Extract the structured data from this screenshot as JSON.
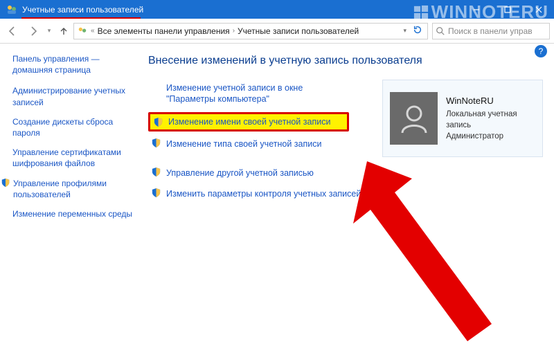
{
  "titlebar": {
    "title": "Учетные записи пользователей"
  },
  "watermark": "WINNOTERU",
  "toolbar": {
    "dropdown_glyph": "▾",
    "breadcrumb_back_glyph": "«",
    "crumb1": "Все элементы панели управления",
    "crumb2": "Учетные записи пользователей",
    "search_placeholder": "Поиск в панели управ"
  },
  "sidebar": {
    "heading": "Панель управления — домашняя страница",
    "links": [
      "Администрирование учетных записей",
      "Создание дискеты сброса пароля",
      "Управление сертификатами шифрования файлов",
      "Управление профилями пользователей",
      "Изменение переменных среды"
    ]
  },
  "main": {
    "heading": "Внесение изменений в учетную запись пользователя",
    "actions": {
      "a0": "Изменение учетной записи в окне \"Параметры компьютера\"",
      "a1": "Изменение имени своей учетной записи",
      "a2": "Изменение типа своей учетной записи",
      "a3": "Управление другой учетной записью",
      "a4": "Изменить параметры контроля учетных записей"
    },
    "user": {
      "name": "WinNoteRU",
      "type": "Локальная учетная запись",
      "role": "Администратор"
    }
  },
  "help_glyph": "?"
}
